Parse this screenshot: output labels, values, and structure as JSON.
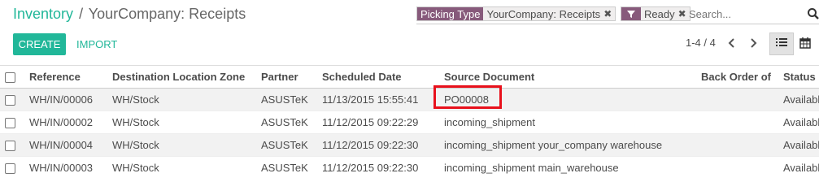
{
  "breadcrumb": {
    "parent": "Inventory",
    "separator": "/",
    "current": "YourCompany: Receipts"
  },
  "search": {
    "facets": [
      {
        "label": "Picking Type",
        "value": "YourCompany: Receipts",
        "icon": "none"
      },
      {
        "label": "",
        "value": "Ready",
        "icon": "filter-icon"
      }
    ],
    "placeholder": "Search..."
  },
  "toolbar": {
    "create_label": "Create",
    "import_label": "Import"
  },
  "pager": {
    "value": "1-4 / 4"
  },
  "table": {
    "columns": [
      "Reference",
      "Destination Location Zone",
      "Partner",
      "Scheduled Date",
      "Source Document",
      "Back Order of",
      "Status"
    ],
    "rows": [
      {
        "reference": "WH/IN/00006",
        "destination": "WH/Stock",
        "partner": "ASUSTeK",
        "scheduled": "11/13/2015 15:55:41",
        "source": "PO00008",
        "backorder": "",
        "status": "Available"
      },
      {
        "reference": "WH/IN/00002",
        "destination": "WH/Stock",
        "partner": "ASUSTeK",
        "scheduled": "11/12/2015 09:22:29",
        "source": "incoming_shipment",
        "backorder": "",
        "status": "Available"
      },
      {
        "reference": "WH/IN/00004",
        "destination": "WH/Stock",
        "partner": "ASUSTeK",
        "scheduled": "11/12/2015 09:22:30",
        "source": "incoming_shipment your_company warehouse",
        "backorder": "",
        "status": "Available"
      },
      {
        "reference": "WH/IN/00003",
        "destination": "WH/Stock",
        "partner": "ASUSTeK",
        "scheduled": "11/12/2015 09:22:30",
        "source": "incoming_shipment main_warehouse",
        "backorder": "",
        "status": "Available"
      }
    ]
  },
  "colors": {
    "accent": "#21b799",
    "facet": "#875a7b",
    "highlight": "#e8101b"
  }
}
